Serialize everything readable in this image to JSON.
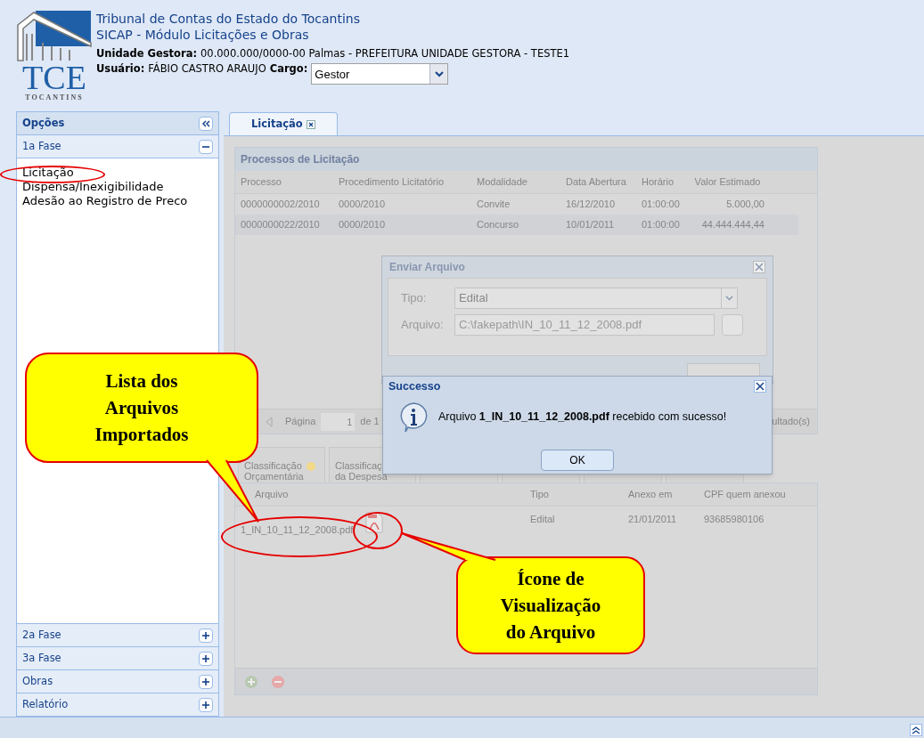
{
  "header": {
    "logo_text": "TCE",
    "logo_subtext": "TOCANTINS",
    "org": "Tribunal de Contas do Estado do Tocantins",
    "module": "SICAP - Módulo Licitações e Obras",
    "unit_label": "Unidade Gestora:",
    "unit_value": "00.000.000/0000-00 Palmas - PREFEITURA UNIDADE GESTORA - TESTE1",
    "user_label": "Usuário:",
    "user_value": "FÁBIO CASTRO ARAUJO",
    "role_label": "Cargo:",
    "role_value": "Gestor"
  },
  "sidebar": {
    "title": "Opções",
    "sections": [
      {
        "label": "1a Fase",
        "expanded": true,
        "items": [
          "Licitação",
          "Dispensa/Inexigibilidade",
          "Adesão ao Registro de Preco"
        ]
      },
      {
        "label": "2a Fase",
        "expanded": false
      },
      {
        "label": "3a Fase",
        "expanded": false
      },
      {
        "label": "Obras",
        "expanded": false
      },
      {
        "label": "Relatório",
        "expanded": false
      }
    ]
  },
  "tabs": [
    {
      "label": "Licitação",
      "selected": true
    }
  ],
  "process_grid": {
    "title": "Processos de Licitação",
    "columns": [
      "Processo",
      "Procedimento Licitatório",
      "Modalidade",
      "Data Abertura",
      "Horário",
      "Valor Estimado"
    ],
    "rows": [
      [
        "0000000002/2010",
        "0000/2010",
        "Convite",
        "16/12/2010",
        "01:00:00",
        "5.000,00"
      ],
      [
        "0000000022/2010",
        "0000/2010",
        "Concurso",
        "10/01/2011",
        "01:00:00",
        "44.444.444,44"
      ]
    ]
  },
  "pager": {
    "page_label": "Página",
    "page": "1",
    "of": "de 1",
    "summary": "ultado(s)"
  },
  "sub_tabs": [
    {
      "label": "Classificação Orçamentária"
    },
    {
      "label": "Classificaç da Despesa"
    }
  ],
  "file_grid": {
    "columns": [
      "Arquivo",
      "Tipo",
      "Anexo em",
      "CPF quem anexou"
    ],
    "rows": [
      [
        "1_IN_10_11_12_2008.pdf",
        "Edital",
        "21/01/2011",
        "93685980106"
      ]
    ]
  },
  "upload_dialog": {
    "title": "Enviar Arquivo",
    "fields": [
      {
        "kind": "select",
        "label": "Tipo:",
        "value": "Edital"
      },
      {
        "kind": "file",
        "label": "Arquivo:",
        "value": "C:\\fakepath\\IN_10_11_12_2008.pdf"
      }
    ]
  },
  "message_dialog": {
    "title": "Successo",
    "message": "Arquivo **1_IN_10_11_12_2008.pdf** recebido com sucesso!",
    "button": "OK"
  },
  "annotations": [
    {
      "text": "Lista dos Arquivos Importados"
    },
    {
      "text": "Ícone de Visualização do Arquivo"
    }
  ]
}
